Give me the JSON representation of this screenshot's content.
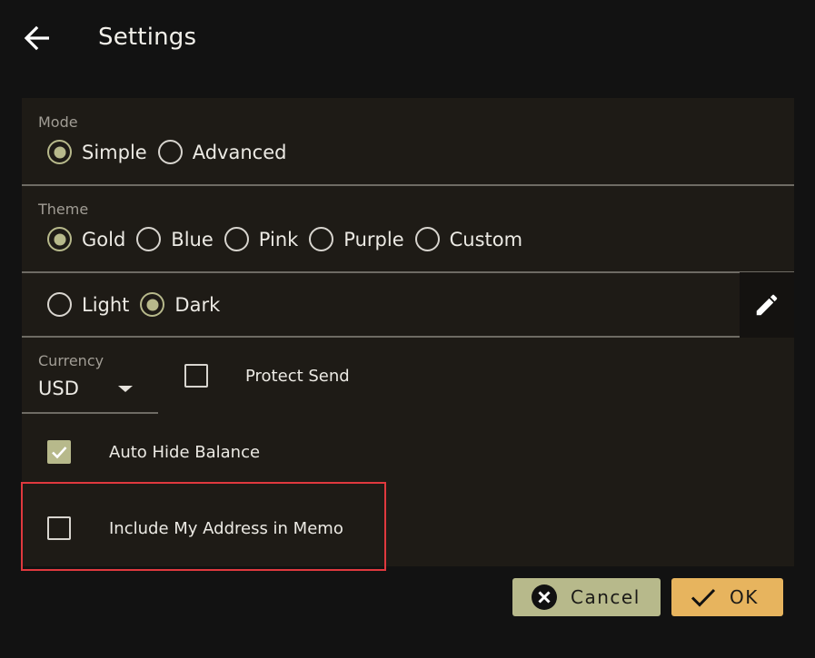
{
  "header": {
    "title": "Settings",
    "back_icon": "arrow-left-icon"
  },
  "mode": {
    "label": "Mode",
    "options": [
      {
        "label": "Simple",
        "checked": true
      },
      {
        "label": "Advanced",
        "checked": false
      }
    ]
  },
  "theme": {
    "label": "Theme",
    "options": [
      {
        "label": "Gold",
        "checked": true
      },
      {
        "label": "Blue",
        "checked": false
      },
      {
        "label": "Pink",
        "checked": false
      },
      {
        "label": "Purple",
        "checked": false
      },
      {
        "label": "Custom",
        "checked": false
      }
    ],
    "brightness": [
      {
        "label": "Light",
        "checked": false
      },
      {
        "label": "Dark",
        "checked": true
      }
    ],
    "edit_icon": "pencil-icon"
  },
  "currency": {
    "label": "Currency",
    "value": "USD"
  },
  "options": {
    "protect_send": {
      "label": "Protect Send",
      "checked": false
    },
    "auto_hide_balance": {
      "label": "Auto Hide Balance",
      "checked": true
    },
    "include_address": {
      "label": "Include My Address in Memo",
      "checked": false
    }
  },
  "buttons": {
    "cancel": {
      "label": "Cancel",
      "icon": "close-circle-icon"
    },
    "ok": {
      "label": "OK",
      "icon": "check-icon"
    }
  },
  "colors": {
    "background": "#121212",
    "panel": "#1e1b16",
    "accent": "#b7b98b",
    "ok": "#e7b45e",
    "highlight": "#e0393e"
  }
}
